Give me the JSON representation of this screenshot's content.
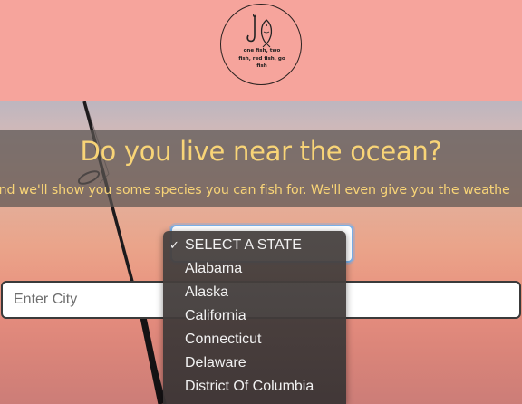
{
  "logo": {
    "text_line1": "one fish, two",
    "text_line2": "fish, red fish, go",
    "text_line3": "fish"
  },
  "hero": {
    "headline": "Do you live near the ocean?",
    "subline": "and we'll show you some species you can fish for. We'll even give you the weathe"
  },
  "state_select": {
    "selected": "SELECT A STATE",
    "options": [
      "SELECT A STATE",
      "Alabama",
      "Alaska",
      "California",
      "Connecticut",
      "Delaware",
      "District Of Columbia"
    ]
  },
  "city_input": {
    "placeholder": "Enter City",
    "value": ""
  },
  "colors": {
    "header_bg": "#f6a49c",
    "headline": "#f8d477",
    "focus_ring": "#7ab0e8"
  }
}
